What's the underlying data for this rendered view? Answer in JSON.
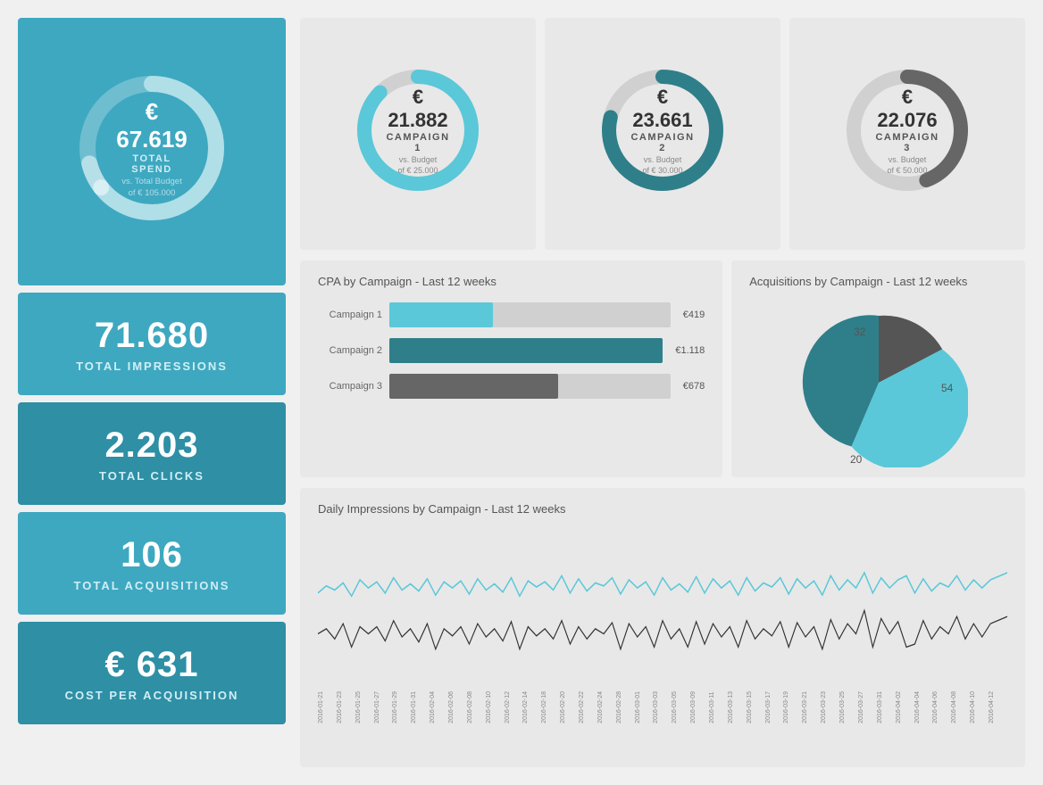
{
  "sidebar": {
    "total_spend": {
      "amount": "€ 67.619",
      "label": "TOTAL SPEND",
      "sub_line1": "vs. Total Budget",
      "sub_line2": "of € 105.000",
      "percent": 64.4
    },
    "total_impressions": {
      "number": "71.680",
      "label": "TOTAL IMPRESSIONS"
    },
    "total_clicks": {
      "number": "2.203",
      "label": "TOTAL CLICKS"
    },
    "total_acquisitions": {
      "number": "106",
      "label": "TOTAL ACQUISITIONS"
    },
    "cost_per_acquisition": {
      "number": "€ 631",
      "label": "COST PER ACQUISITION"
    }
  },
  "campaigns": [
    {
      "id": "campaign1",
      "amount": "€ 21.882",
      "name": "CAMPAIGN 1",
      "sub_line1": "vs. Budget",
      "sub_line2": "of € 25.000",
      "percent": 87.5,
      "color": "#5ac8d8"
    },
    {
      "id": "campaign2",
      "amount": "€ 23.661",
      "name": "CAMPAIGN 2",
      "sub_line1": "vs. Budget",
      "sub_line2": "of € 30.000",
      "percent": 78.9,
      "color": "#2e7f8a"
    },
    {
      "id": "campaign3",
      "amount": "€ 22.076",
      "name": "CAMPAIGN 3",
      "sub_line1": "vs. Budget",
      "sub_line2": "of € 50.000",
      "percent": 44.2,
      "color": "#666666"
    }
  ],
  "cpa_chart": {
    "title": "CPA by Campaign - Last 12 weeks",
    "bars": [
      {
        "label": "Campaign 1",
        "value": "€419",
        "percent": 37,
        "color": "#5ac8d8"
      },
      {
        "label": "Campaign 2",
        "value": "€1.118",
        "percent": 100,
        "color": "#2e7f8a"
      },
      {
        "label": "Campaign 3",
        "value": "€678",
        "percent": 60,
        "color": "#666666"
      }
    ]
  },
  "acquisitions_chart": {
    "title": "Acquisitions by Campaign - Last 12 weeks",
    "segments": [
      {
        "label": "32",
        "value": 32,
        "color": "#555555"
      },
      {
        "label": "54",
        "value": 54,
        "color": "#5ac8d8"
      },
      {
        "label": "20",
        "value": 20,
        "color": "#2e7f8a"
      }
    ]
  },
  "impressions_chart": {
    "title": "Daily Impressions by Campaign - Last 12 weeks",
    "x_labels": [
      "2016-01-21",
      "2016-01-23",
      "2016-01-25",
      "2016-01-27",
      "2016-01-29",
      "2016-01-31",
      "2016-02-02",
      "2016-02-04",
      "2016-02-06",
      "2016-02-08",
      "2016-02-10",
      "2016-02-12",
      "2016-02-14",
      "2016-02-16",
      "2016-02-18",
      "2016-02-20",
      "2016-02-22",
      "2016-02-24",
      "2016-02-26",
      "2016-02-28",
      "2016-03-01",
      "2016-03-03",
      "2016-03-05",
      "2016-03-07",
      "2016-03-09",
      "2016-03-11",
      "2016-03-13",
      "2016-03-15",
      "2016-03-17",
      "2016-03-19",
      "2016-03-21",
      "2016-03-23",
      "2016-03-25",
      "2016-03-27",
      "2016-03-29",
      "2016-03-31",
      "2016-04-02",
      "2016-04-04",
      "2016-04-06",
      "2016-04-08",
      "2016-04-10",
      "2016-04-12"
    ]
  },
  "colors": {
    "sidebar_bg": "#3ea8c0",
    "sidebar_dark": "#2e8fa5",
    "campaign1": "#5ac8d8",
    "campaign2": "#2e7f8a",
    "campaign3": "#666666",
    "card_bg": "#e8e8e8"
  }
}
